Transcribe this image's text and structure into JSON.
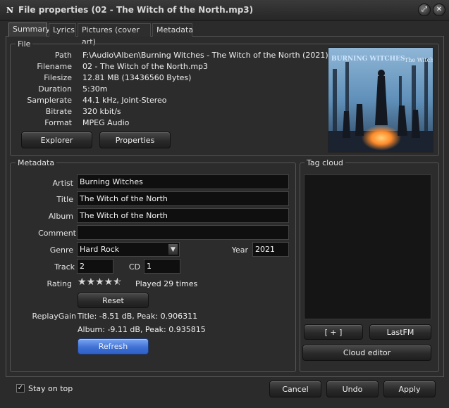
{
  "window": {
    "title": "File properties (02 - The Witch of the North.mp3)",
    "app_icon_glyph": "N",
    "close_glyph": "✕",
    "restore_glyph": "⤢"
  },
  "tabs": [
    {
      "label": "Summary",
      "active": true
    },
    {
      "label": "Lyrics",
      "active": false
    },
    {
      "label": "Pictures (cover art)",
      "active": false
    },
    {
      "label": "Metadata",
      "active": false
    }
  ],
  "file": {
    "group_label": "File",
    "rows": [
      {
        "label": "Path",
        "value": "F:\\Audio\\Alben\\Burning Witches - The Witch of the North (2021)"
      },
      {
        "label": "Filename",
        "value": "02 - The Witch of the North.mp3"
      },
      {
        "label": "Filesize",
        "value": "12.81 MB (13436560 Bytes)"
      },
      {
        "label": "Duration",
        "value": "5:30m"
      },
      {
        "label": "Samplerate",
        "value": "44.1 kHz, Joint-Stereo"
      },
      {
        "label": "Bitrate",
        "value": "320 kbit/s"
      },
      {
        "label": "Format",
        "value": "MPEG Audio"
      }
    ],
    "explorer_button": "Explorer",
    "properties_button": "Properties",
    "cover_text": {
      "band": "BURNING WITCHES",
      "album": "The Witch of the North"
    }
  },
  "metadata": {
    "group_label": "Metadata",
    "artist_label": "Artist",
    "artist_value": "Burning Witches",
    "title_label": "Title",
    "title_value": "The Witch of the North",
    "album_label": "Album",
    "album_value": "The Witch of the North",
    "comment_label": "Comment",
    "comment_value": "",
    "genre_label": "Genre",
    "genre_value": "Hard Rock",
    "year_label": "Year",
    "year_value": "2021",
    "track_label": "Track",
    "track_value": "2",
    "cd_label": "CD",
    "cd_value": "1",
    "rating_label": "Rating",
    "rating_stars": 4.5,
    "rating_max": 5,
    "played_text": "Played 29 times",
    "reset_button": "Reset",
    "replaygain_label": "ReplayGain",
    "replaygain_title": "Title: -8.51 dB, Peak: 0.906311",
    "replaygain_album": "Album: -9.11 dB, Peak: 0.935815",
    "refresh_button": "Refresh"
  },
  "tagcloud": {
    "group_label": "Tag cloud",
    "add_button": "[ + ]",
    "lastfm_button": "LastFM",
    "cloud_editor_button": "Cloud editor"
  },
  "footer": {
    "stay_on_top_label": "Stay on top",
    "stay_on_top_checked": true,
    "cancel_button": "Cancel",
    "undo_button": "Undo",
    "apply_button": "Apply"
  },
  "colors": {
    "background": "#2b2b2b",
    "field_background": "#0f0f0f",
    "accent_button": "#3f72d6"
  }
}
